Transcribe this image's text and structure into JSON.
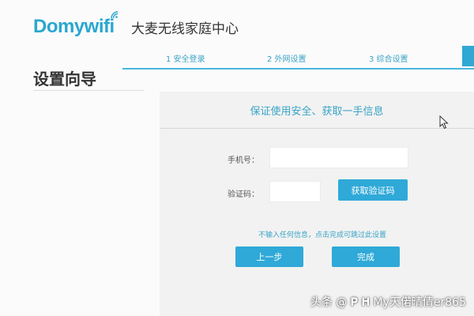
{
  "brand": {
    "logo_text": "Domywifi",
    "title": "大麦无线家庭中心",
    "accent_color": "#2aa7cf"
  },
  "steps": [
    {
      "label": "1 安全登录"
    },
    {
      "label": "2 外网设置"
    },
    {
      "label": "3 综合设置"
    }
  ],
  "wizard": {
    "title": "设置向导"
  },
  "card": {
    "header": "保证使用安全、获取一手信息",
    "phone_label": "手机号：",
    "phone_value": "",
    "code_label": "验证码：",
    "code_value": "",
    "get_code_button": "获取验证码",
    "hint": "不输入任何信息，点击完成可跳过此设置",
    "prev_button": "上一步",
    "finish_button": "完成"
  },
  "icons": {
    "signal": "wifi-signal-icon",
    "cursor": "mouse-cursor-icon"
  },
  "watermark": "头条 @ 𝐏 𝐇 My天偌晴倩er865"
}
